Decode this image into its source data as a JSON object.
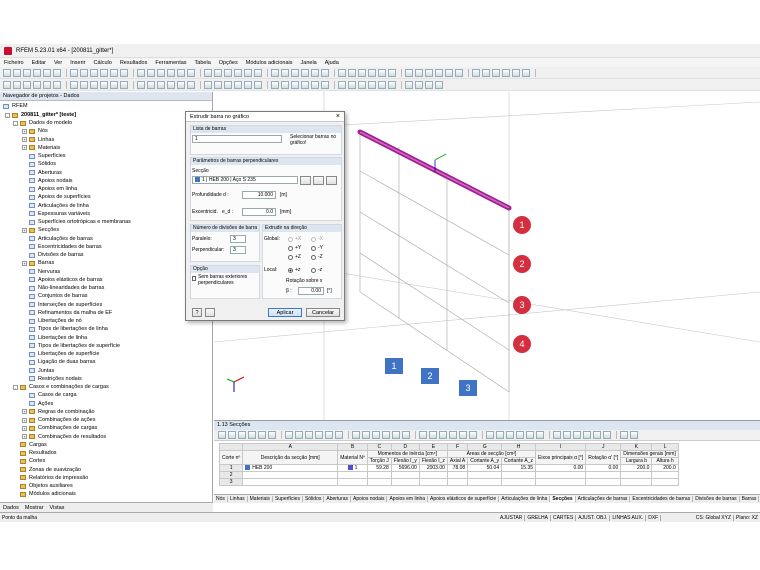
{
  "window": {
    "title": "RFEM 5.23.01 x64 - [200811_gitter*]"
  },
  "menu": [
    "Ficheiro",
    "Editar",
    "Ver",
    "Inserir",
    "Cálculo",
    "Resultados",
    "Ferramentas",
    "Tabela",
    "Opções",
    "Módulos adicionais",
    "Janela",
    "Ajuda"
  ],
  "navigator": {
    "header": "Navegador de projetos - Dados",
    "root": "RFEM",
    "project": "200811_gitter* [teste]",
    "items": [
      "Dados do modelo",
      "Nós",
      "Linhas",
      "Materiais",
      "Superfícies",
      "Sólidos",
      "Aberturas",
      "Apoios nodais",
      "Apoios em linha",
      "Apoios de superfícies",
      "Articulações de linha",
      "Espessuras variáveis",
      "Superfícies ortotrópicas e membranas",
      "Secções",
      "Articulações de barras",
      "Excentricidades de barras",
      "Divisões de barras",
      "Barras",
      "Nervuras",
      "Apoios elásticos de barras",
      "Não-linearidades de barras",
      "Conjuntos de barras",
      "Interseções de superfícies",
      "Refinamentos da malha de EF",
      "Libertações de nó",
      "Tipos de libertações de linha",
      "Libertações de linha",
      "Tipos de libertações de superfície",
      "Libertações de superfície",
      "Ligação de duas barras",
      "Juntas",
      "Restrições nodais",
      "Casos e combinações de cargas",
      "Casos de carga",
      "Ações",
      "Regras de combinação",
      "Combinações de ações",
      "Combinações de cargas",
      "Combinações de resultados",
      "Cargas",
      "Resultados",
      "Cortes",
      "Zonas de suavização",
      "Relatórios de impressão",
      "Objetos auxiliares",
      "Módulos adicionais"
    ],
    "tabs": [
      "Dados",
      "Mostrar",
      "Vistas"
    ]
  },
  "dialog": {
    "title": "Extrudir barra no gráfico",
    "bars_group": "Lista de barras",
    "bars_value": "1",
    "bars_hint": "Selecionar barras no gráfico!",
    "params_group": "Parâmetros de barras perpendiculares",
    "section_label": "Secção",
    "section_value": "1 | HEB 200 | Aço S 235",
    "depth_label": "Profundidade d :",
    "depth_value": "10.000",
    "depth_unit": "[m]",
    "ecc_label": "Excentricid.",
    "ecc_sub": "e_d :",
    "ecc_value": "0.0",
    "ecc_unit": "[mm]",
    "divisions_group": "Número de divisões de barra",
    "parallel_label": "Paralelo:",
    "parallel_value": "3",
    "perp_label": "Perpendicular:",
    "perp_value": "3",
    "direction_group": "Extrudir na direção",
    "global_label": "Global:",
    "global_options": [
      "+X",
      "-X",
      "+Y",
      "-Y",
      "+Z",
      "-Z"
    ],
    "local_label": "Local:",
    "local_options": [
      "+z",
      "-z"
    ],
    "rotation_label": "Rotação sobre x",
    "beta_label": "β :",
    "beta_value": "0.00",
    "beta_unit": "[°]",
    "option_group": "Opção",
    "option_checkbox": "Sem barras exteriores perpendiculares",
    "apply": "Aplicar",
    "cancel": "Cancelar"
  },
  "viewport": {
    "callouts_red": [
      "1",
      "2",
      "3",
      "4"
    ],
    "callouts_blue": [
      "1",
      "2",
      "3"
    ],
    "colors": {
      "red": "#d32f3f",
      "blue": "#3f74c4",
      "member": "#a0208c"
    }
  },
  "panel": {
    "title": "1.13 Secções",
    "col_letters": [
      "A",
      "B",
      "C",
      "D",
      "E",
      "F",
      "G",
      "H",
      "I",
      "J",
      "K",
      "L"
    ],
    "headers": {
      "corte": "Corte nº",
      "descricao": "Descrição da secção [mm]",
      "material": "Material Nº",
      "inercia": "Momentos de inércia [cm⁴]",
      "torcao": "Torção J",
      "flexao_y": "Flexão I_y",
      "flexao_z": "Flexão I_z",
      "areas": "Áreas de secção [cm²]",
      "axial": "Axial A",
      "cortante_y": "Cortante A_y",
      "cortante_z": "Cortante A_z",
      "eixos": "Eixos principais α [°]",
      "rotacao": "Rotação α' [°]",
      "dimensoes": "Dimensões gerais [mm]",
      "largura": "Largura b",
      "altura": "Altura h"
    },
    "rows": [
      {
        "n": "1",
        "desc": "HEB 200",
        "mat": "1",
        "J": "59.28",
        "Iy": "5696.00",
        "Iz": "2003.00",
        "A": "78.08",
        "Ay": "50.04",
        "Az": "15.35",
        "alpha": "0.00",
        "rot": "0.00",
        "b": "200.0",
        "h": "200.0"
      },
      {
        "n": "2"
      },
      {
        "n": "3"
      }
    ],
    "sheet_tabs": [
      "Nós",
      "Linhas",
      "Materiais",
      "Superfícies",
      "Sólidos",
      "Aberturas",
      "Apoios nodais",
      "Apoios em linha",
      "Apoios elásticos de superfície",
      "Articulações de linha",
      "Secções",
      "Articulações de barras",
      "Excentricidades de barras",
      "Divisões de barras",
      "Barras",
      "Nerv"
    ]
  },
  "status": {
    "left": "Ponto da malha",
    "toggles": [
      "AJUSTAR",
      "GRELHA",
      "CARTES",
      "AJUST. OBJ.",
      "LINHAS AUX.",
      "DXF"
    ],
    "cs": "CS: Global XYZ",
    "plane": "Plano: XZ"
  }
}
